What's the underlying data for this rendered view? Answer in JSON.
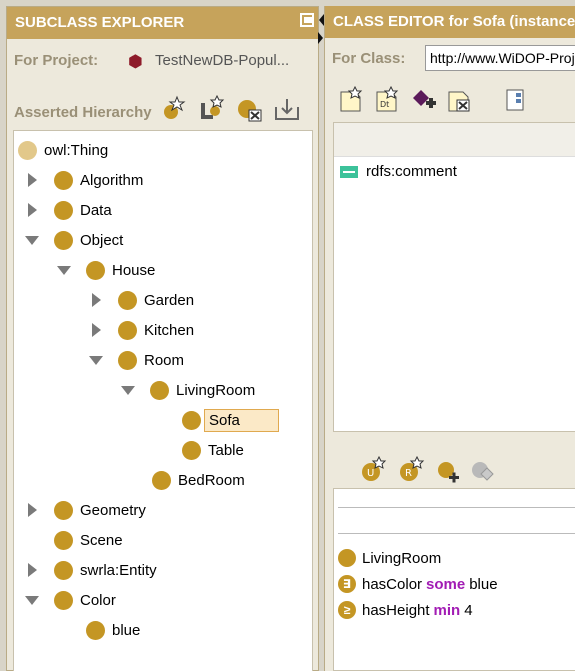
{
  "left": {
    "title": "SUBCLASS EXPLORER",
    "project_label": "For Project:",
    "project_name": "TestNewDB-Popul...",
    "hierarchy_label": "Asserted Hierarchy"
  },
  "tree": [
    {
      "label": "owl:Thing",
      "arrow": "none",
      "dot": "light"
    },
    {
      "label": "Algorithm",
      "arrow": "collapsed"
    },
    {
      "label": "Data",
      "arrow": "collapsed"
    },
    {
      "label": "Object",
      "arrow": "expanded"
    },
    {
      "label": "House",
      "arrow": "expanded"
    },
    {
      "label": "Garden",
      "arrow": "collapsed"
    },
    {
      "label": "Kitchen",
      "arrow": "collapsed"
    },
    {
      "label": "Room",
      "arrow": "expanded"
    },
    {
      "label": "LivingRoom",
      "arrow": "expanded"
    },
    {
      "label": "Sofa",
      "arrow": "none",
      "selected": true
    },
    {
      "label": "Table",
      "arrow": "none"
    },
    {
      "label": "BedRoom",
      "arrow": "none"
    },
    {
      "label": "Geometry",
      "arrow": "collapsed"
    },
    {
      "label": "Scene",
      "arrow": "none"
    },
    {
      "label": "swrla:Entity",
      "arrow": "collapsed"
    },
    {
      "label": "Color",
      "arrow": "expanded"
    },
    {
      "label": "blue",
      "arrow": "none"
    }
  ],
  "right": {
    "title": "CLASS EDITOR for Sofa   (instance of owl:Class)",
    "class_label": "For Class:",
    "class_value": "http://www.WiDOP-Project.org",
    "annotation": "rdfs:comment",
    "conditions": [
      {
        "icon": "",
        "text": "LivingRoom",
        "keyword": "",
        "value": ""
      },
      {
        "icon": "∃",
        "text": "hasColor",
        "keyword": "some",
        "value": "blue"
      },
      {
        "icon": "≥",
        "text": "hasHeight",
        "keyword": "min",
        "value": "4"
      }
    ]
  },
  "colors": {
    "header_gold": "#c6a35b",
    "class_dot": "#c49624",
    "keyword_purple": "#a21cb4",
    "annotation_green": "#3cc29a",
    "selection_border": "#e0a94f"
  }
}
